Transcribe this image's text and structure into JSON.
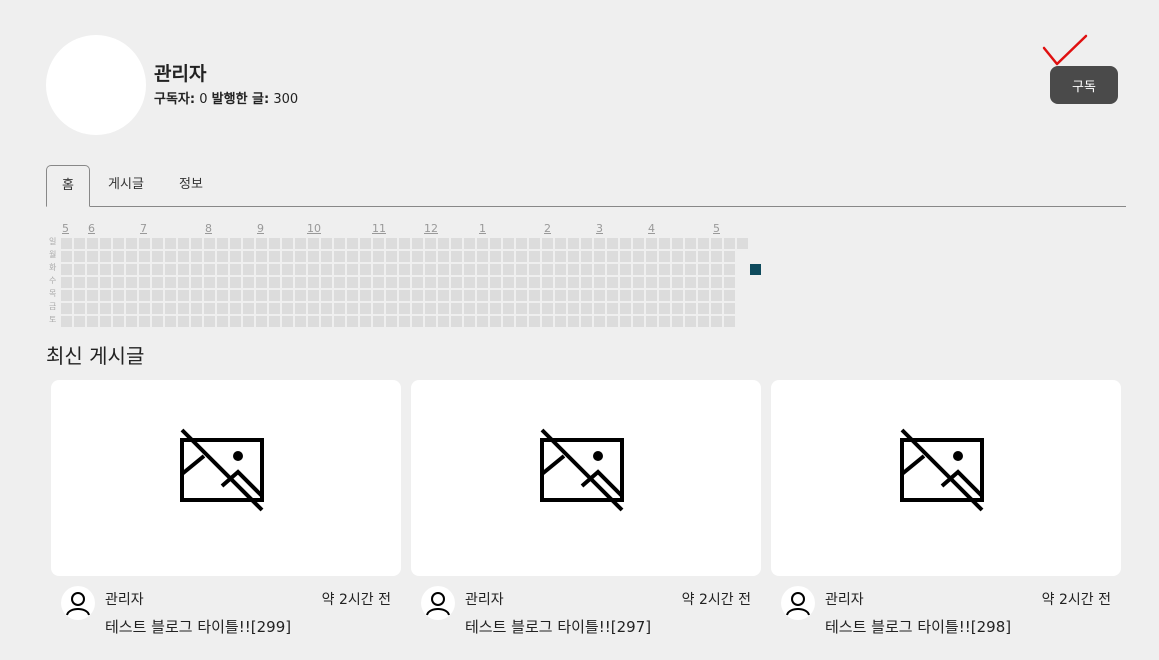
{
  "profile": {
    "name": "관리자",
    "subscribers_label": "구독자:",
    "subscribers_count": "0",
    "posts_label": "발행한 글:",
    "posts_count": "300",
    "subscribe_button": "구독"
  },
  "tabs": [
    {
      "label": "홈",
      "active": true
    },
    {
      "label": "게시글",
      "active": false
    },
    {
      "label": "정보",
      "active": false
    }
  ],
  "heatmap": {
    "months": [
      "5",
      "6",
      "7",
      "8",
      "9",
      "10",
      "11",
      "12",
      "1",
      "2",
      "3",
      "4",
      "5"
    ],
    "days": [
      "일",
      "월",
      "화",
      "수",
      "목",
      "금",
      "토"
    ],
    "active_color": "#0e4a5c",
    "empty_color": "#dcdcdc"
  },
  "recent": {
    "title": "최신 게시글",
    "posts": [
      {
        "author": "관리자",
        "time": "약 2시간 전",
        "title": "테스트 블로그 타이틀!![299]",
        "thumbnail_icon": "image-off-icon"
      },
      {
        "author": "관리자",
        "time": "약 2시간 전",
        "title": "테스트 블로그 타이틀!![297]",
        "thumbnail_icon": "image-off-icon"
      },
      {
        "author": "관리자",
        "time": "약 2시간 전",
        "title": "테스트 블로그 타이틀!![298]",
        "thumbnail_icon": "image-off-icon"
      }
    ]
  }
}
